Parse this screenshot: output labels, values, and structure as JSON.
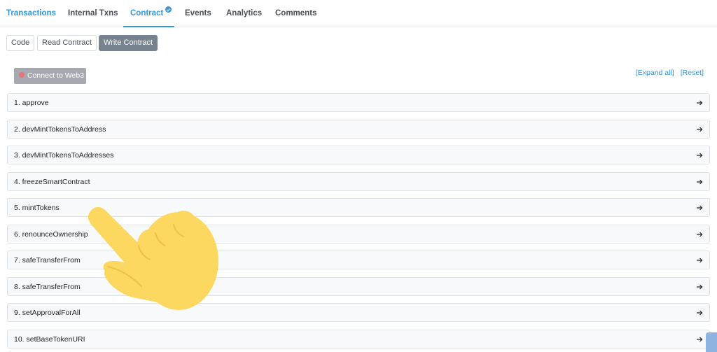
{
  "tabs": [
    {
      "label": "Transactions"
    },
    {
      "label": "Internal Txns"
    },
    {
      "label": "Contract"
    },
    {
      "label": "Events"
    },
    {
      "label": "Analytics"
    },
    {
      "label": "Comments"
    }
  ],
  "subtabs": [
    {
      "label": "Code"
    },
    {
      "label": "Read Contract"
    },
    {
      "label": "Write Contract"
    }
  ],
  "connect_button": {
    "label": "Connect to Web3"
  },
  "links": {
    "expand": "[Expand all]",
    "reset": "[Reset]"
  },
  "functions": [
    {
      "label": "1. approve"
    },
    {
      "label": "2. devMintTokensToAddress"
    },
    {
      "label": "3. devMintTokensToAddresses"
    },
    {
      "label": "4. freezeSmartContract"
    },
    {
      "label": "5. mintTokens"
    },
    {
      "label": "6. renounceOwnership"
    },
    {
      "label": "7. safeTransferFrom"
    },
    {
      "label": "8. safeTransferFrom"
    },
    {
      "label": "9. setApprovalForAll"
    },
    {
      "label": "10. setBaseTokenURI"
    }
  ],
  "colors": {
    "accent": "#3498db",
    "active_subtab": "#77838f",
    "hand": "#fcd860",
    "connect_dot": "#e8747a"
  },
  "icons": {
    "verified": "check-circle-icon",
    "row_arrow": "arrow-right-icon",
    "pointer": "pointing-hand-icon",
    "status": "red-dot-icon"
  }
}
